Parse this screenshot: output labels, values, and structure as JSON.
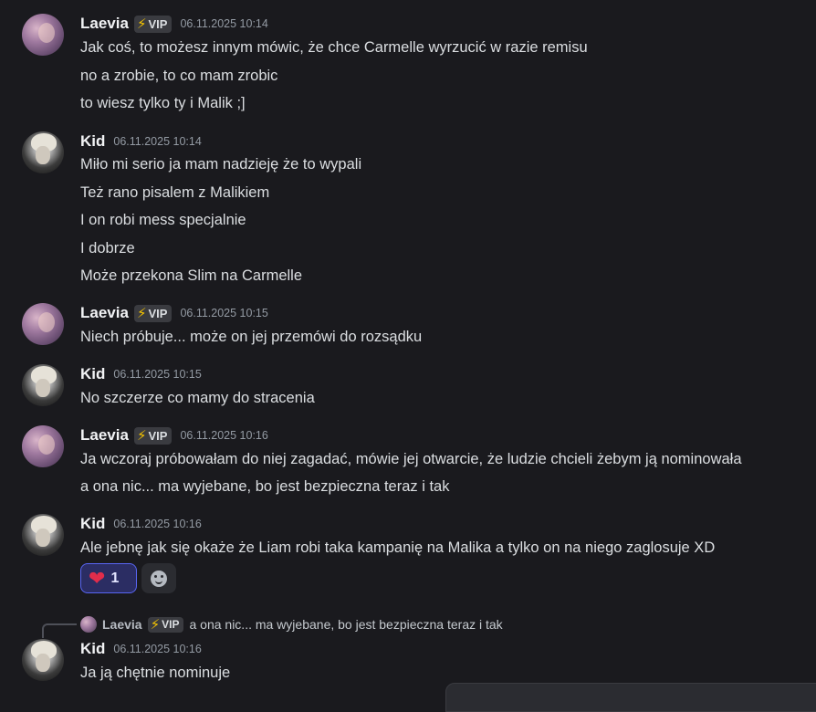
{
  "messages": [
    {
      "author": "Laevia",
      "badge": "VIP",
      "time": "06.11.2025 10:14",
      "lines": [
        "Jak coś, to możesz innym mówic, że chce Carmelle wyrzucić w razie remisu",
        "no a zrobie, to co mam zrobic",
        "to wiesz tylko ty i Malik ;]"
      ]
    },
    {
      "author": "Kid",
      "time": "06.11.2025 10:14",
      "lines": [
        "Miło mi serio ja mam nadzieję że to wypali",
        "Też rano pisalem z Malikiem",
        "I on robi mess specjalnie",
        "I dobrze",
        "Może przekona Slim na Carmelle"
      ]
    },
    {
      "author": "Laevia",
      "badge": "VIP",
      "time": "06.11.2025 10:15",
      "lines": [
        "Niech próbuje... może on jej przemówi do rozsądku"
      ]
    },
    {
      "author": "Kid",
      "time": "06.11.2025 10:15",
      "lines": [
        "No szczerze co mamy do stracenia"
      ]
    },
    {
      "author": "Laevia",
      "badge": "VIP",
      "time": "06.11.2025 10:16",
      "lines": [
        "Ja wczoraj próbowałam do niej zagadać, mówie jej otwarcie, że ludzie chcieli żebym ją nominowała",
        "a ona nic... ma wyjebane, bo jest bezpieczna teraz i tak"
      ]
    },
    {
      "author": "Kid",
      "time": "06.11.2025 10:16",
      "lines": [
        "Ale jebnę jak się okaże że Liam robi taka kampanię na Malika a tylko on na niego zaglosuje XD"
      ],
      "reaction": {
        "emoji": "heart",
        "count": "1"
      }
    },
    {
      "author": "Kid",
      "time": "06.11.2025 10:16",
      "lines": [
        "Ja ją chętnie nominuje"
      ]
    }
  ],
  "reply": {
    "author": "Laevia",
    "badge": "VIP",
    "text": "a ona nic... ma wyjebane, bo jest bezpieczna teraz i tak"
  },
  "colors": {
    "background": "#1a1a1e",
    "vip_bolt": "#f5c400",
    "reaction_border": "#5865f2",
    "heart": "#e12d4b"
  }
}
